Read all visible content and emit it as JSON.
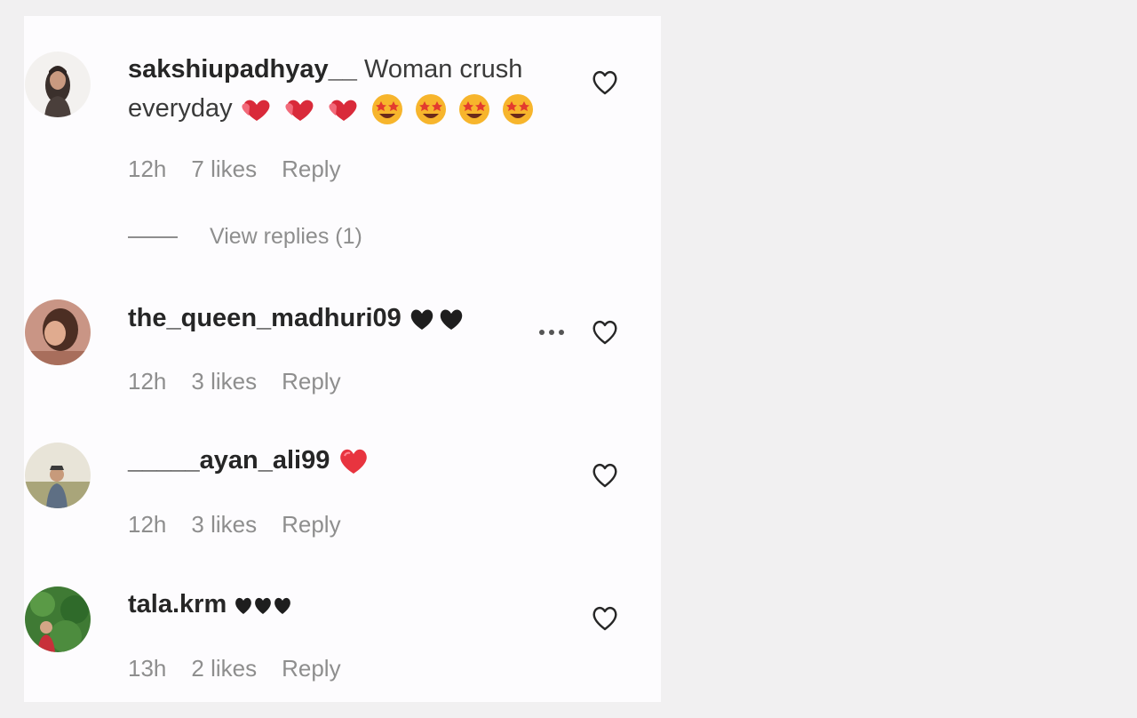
{
  "comments": [
    {
      "username": "sakshiupadhyay__",
      "text": "Woman crush everyday",
      "emojis": [
        "two-hearts",
        "two-hearts",
        "two-hearts",
        "star-struck",
        "star-struck",
        "star-struck",
        "star-struck"
      ],
      "time": "12h",
      "likes": "7 likes",
      "reply": "Reply",
      "view_replies": "View replies (1)"
    },
    {
      "username": "the_queen_madhuri09",
      "text": "",
      "emojis": [
        "black-heart",
        "black-heart"
      ],
      "time": "12h",
      "likes": "3 likes",
      "reply": "Reply"
    },
    {
      "username": "_____ayan_ali99",
      "text": "",
      "emojis": [
        "red-heart"
      ],
      "time": "12h",
      "likes": "3 likes",
      "reply": "Reply"
    },
    {
      "username": "tala.krm",
      "text": "",
      "emojis": [
        "black-heart-suit",
        "black-heart-suit",
        "black-heart-suit"
      ],
      "time": "13h",
      "likes": "2 likes",
      "reply": "Reply"
    }
  ],
  "colors": {
    "background": "#f1f0f1",
    "panel": "#fdfcfe",
    "text_primary": "#262626",
    "text_secondary": "#8e8e8e",
    "heart_red": "#e8343f",
    "emoji_yellow": "#f7b52c"
  }
}
